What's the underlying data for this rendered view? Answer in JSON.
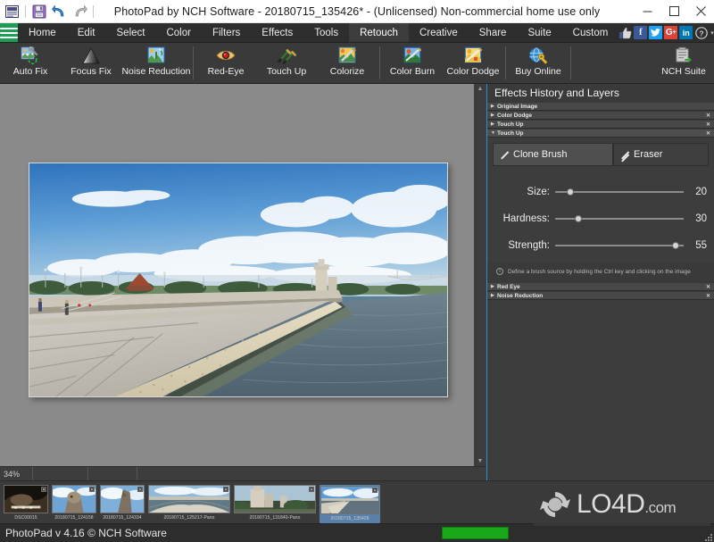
{
  "window": {
    "title": "PhotoPad by NCH Software - 20180715_135426* - (Unlicensed) Non-commercial home use only",
    "minimize": "–",
    "maximize": "☐",
    "close": "×",
    "quick_access": [
      {
        "name": "app-menu-icon",
        "glyph": "▤"
      },
      {
        "name": "save-icon",
        "glyph": "Ὃe"
      },
      {
        "name": "undo-icon",
        "glyph": "↶"
      },
      {
        "name": "redo-icon",
        "glyph": "↷"
      }
    ]
  },
  "ribbon": {
    "menu_button": "☰",
    "tabs": [
      {
        "label": "Home",
        "active": false
      },
      {
        "label": "Edit",
        "active": false
      },
      {
        "label": "Select",
        "active": false
      },
      {
        "label": "Color",
        "active": false
      },
      {
        "label": "Filters",
        "active": false
      },
      {
        "label": "Effects",
        "active": false
      },
      {
        "label": "Tools",
        "active": false
      },
      {
        "label": "Retouch",
        "active": true
      },
      {
        "label": "Creative",
        "active": false
      },
      {
        "label": "Share",
        "active": false
      },
      {
        "label": "Suite",
        "active": false
      },
      {
        "label": "Custom",
        "active": false
      }
    ],
    "social": [
      {
        "name": "thumbs-up-icon",
        "glyph": "👍"
      },
      {
        "name": "facebook-icon",
        "glyph": "f"
      },
      {
        "name": "twitter-icon",
        "glyph": "ᵗ"
      },
      {
        "name": "google-plus-icon",
        "glyph": "G+"
      },
      {
        "name": "linkedin-icon",
        "glyph": "in"
      },
      {
        "name": "help-icon",
        "glyph": "?"
      },
      {
        "name": "overflow-caret-icon",
        "glyph": "▾"
      }
    ]
  },
  "toolbar": {
    "buttons": [
      {
        "label": "Auto Fix",
        "icon": "auto-fix-icon"
      },
      {
        "label": "Focus Fix",
        "icon": "focus-fix-icon"
      },
      {
        "label": "Noise Reduction",
        "icon": "noise-reduction-icon"
      },
      {
        "label": "Red-Eye",
        "icon": "red-eye-icon"
      },
      {
        "label": "Touch Up",
        "icon": "touch-up-icon"
      },
      {
        "label": "Colorize",
        "icon": "colorize-icon"
      },
      {
        "label": "Color Burn",
        "icon": "color-burn-icon"
      },
      {
        "label": "Color Dodge",
        "icon": "color-dodge-icon"
      },
      {
        "label": "Buy Online",
        "icon": "buy-online-icon"
      },
      {
        "label": "NCH Suite",
        "icon": "nch-suite-icon"
      }
    ]
  },
  "panel": {
    "title": "Effects History and Layers",
    "history": [
      {
        "label": "Original Image",
        "expanded": false,
        "closable": false,
        "selected": false
      },
      {
        "label": "Color Dodge",
        "expanded": false,
        "closable": true,
        "selected": false
      },
      {
        "label": "Touch Up",
        "expanded": false,
        "closable": true,
        "selected": false
      },
      {
        "label": "Touch Up",
        "expanded": true,
        "closable": true,
        "selected": true
      }
    ],
    "brush_tabs": [
      {
        "label": "Clone Brush",
        "active": true
      },
      {
        "label": "Eraser",
        "active": false
      }
    ],
    "sliders": [
      {
        "label": "Size:",
        "value": "20",
        "percent": 12
      },
      {
        "label": "Hardness:",
        "value": "30",
        "percent": 18
      },
      {
        "label": "Strength:",
        "value": "55",
        "percent": 94
      }
    ],
    "hint": "Define a brush source by holding the Ctrl key and clicking on the image",
    "history_bottom": [
      {
        "label": "Red Eye",
        "expanded": false,
        "closable": true
      },
      {
        "label": "Noise Reduction",
        "expanded": false,
        "closable": true
      }
    ]
  },
  "status": {
    "zoom": "34%",
    "cell_1": "",
    "cell_2": "",
    "cell_3": ""
  },
  "filmstrip": {
    "items": [
      {
        "caption": "DSC00015",
        "selected": false,
        "width": "t-w1"
      },
      {
        "caption": "20180715_124158",
        "selected": false,
        "width": "t-w2"
      },
      {
        "caption": "20180715_124334",
        "selected": false,
        "width": "t-w3"
      },
      {
        "caption": "20180715_125217-Pano",
        "selected": false,
        "width": "t-w4"
      },
      {
        "caption": "20180715_131840-Pano",
        "selected": false,
        "width": "t-w5"
      },
      {
        "caption": "20180715_135426",
        "selected": true,
        "width": "t-w6"
      }
    ]
  },
  "bottom": {
    "version_text": "PhotoPad v 4.16 © NCH Software",
    "progress_percent": 100
  },
  "watermark": {
    "text": "LO4D",
    "suffix": ".com"
  },
  "colors": {
    "accent_green": "#1f9d55",
    "progress_green": "#19a819",
    "panel_border_blue": "#2a90d8",
    "titlebar_bg": "#ffffff",
    "ribbon_bg": "#2e2e2e",
    "toolbar_bg": "#3a3a3a",
    "canvas_bg": "#8a8a8a"
  }
}
